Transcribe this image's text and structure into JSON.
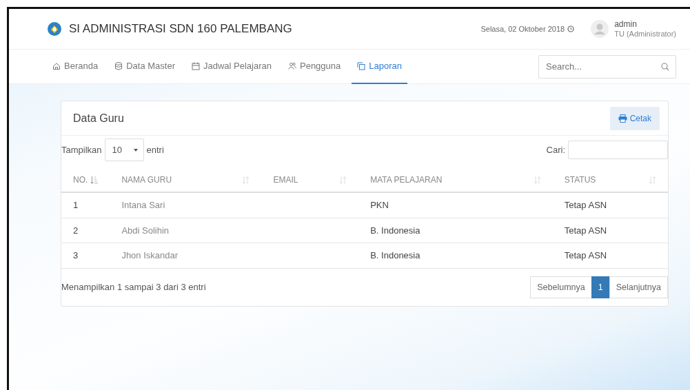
{
  "header": {
    "title": "SI ADMINISTRASI SDN 160 PALEMBANG",
    "date": "Selasa, 02 Oktober 2018",
    "user": {
      "name": "admin",
      "role": "TU (Administrator)"
    }
  },
  "nav": [
    {
      "label": "Beranda",
      "selected": false
    },
    {
      "label": "Data Master",
      "selected": false
    },
    {
      "label": "Jadwal Pelajaran",
      "selected": false
    },
    {
      "label": "Pengguna",
      "selected": false
    },
    {
      "label": "Laporan",
      "selected": true
    }
  ],
  "search": {
    "placeholder": "Search..."
  },
  "card": {
    "title": "Data Guru",
    "print_button": "Cetak",
    "length_label": "Tampilkan",
    "length_value": "10",
    "length_suffix": "entri",
    "filter_label": "Cari:",
    "table": {
      "columns": [
        {
          "label": "NO.",
          "sorted": true
        },
        {
          "label": "NAMA GURU",
          "sorted": false
        },
        {
          "label": "EMAIL",
          "sorted": false
        },
        {
          "label": "MATA PELAJARAN",
          "sorted": false
        },
        {
          "label": "STATUS",
          "sorted": false
        }
      ],
      "rows": [
        [
          "1",
          "Intana Sari",
          "",
          "PKN",
          "Tetap ASN"
        ],
        [
          "2",
          "Abdi Solihin",
          "",
          "B. Indonesia",
          "Tetap ASN"
        ],
        [
          "3",
          "Jhon Iskandar",
          "",
          "B. Indonesia",
          "Tetap ASN"
        ]
      ]
    },
    "info": "Menampilkan 1 sampai 3 dari 3 entri",
    "pagination": [
      {
        "label": "Sebelumnya",
        "selected": false
      },
      {
        "label": "1",
        "selected": true
      },
      {
        "label": "Selanjutnya",
        "selected": false
      }
    ]
  }
}
